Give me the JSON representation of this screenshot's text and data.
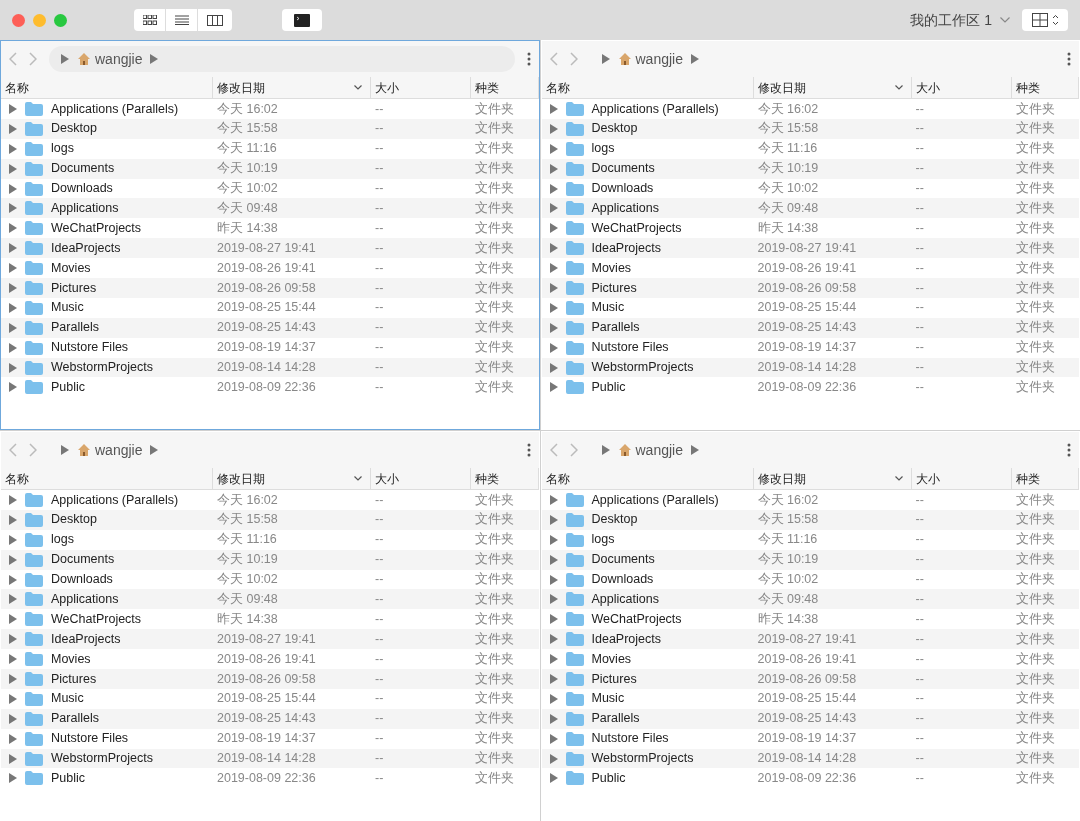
{
  "toolbar": {
    "workspace": "我的工作区 1"
  },
  "panes": [
    {
      "selected": true,
      "breadcrumb": "wangjie",
      "columns": [
        "名称",
        "修改日期",
        "大小",
        "种类"
      ],
      "rows": [
        [
          "Applications (Parallels)",
          "今天 16:02",
          "--",
          "文件夹"
        ],
        [
          "Desktop",
          "今天 15:58",
          "--",
          "文件夹"
        ],
        [
          "logs",
          "今天 11:16",
          "--",
          "文件夹"
        ],
        [
          "Documents",
          "今天 10:19",
          "--",
          "文件夹"
        ],
        [
          "Downloads",
          "今天 10:02",
          "--",
          "文件夹"
        ],
        [
          "Applications",
          "今天 09:48",
          "--",
          "文件夹"
        ],
        [
          "WeChatProjects",
          "昨天 14:38",
          "--",
          "文件夹"
        ],
        [
          "IdeaProjects",
          "2019-08-27 19:41",
          "--",
          "文件夹"
        ],
        [
          "Movies",
          "2019-08-26 19:41",
          "--",
          "文件夹"
        ],
        [
          "Pictures",
          "2019-08-26 09:58",
          "--",
          "文件夹"
        ],
        [
          "Music",
          "2019-08-25 15:44",
          "--",
          "文件夹"
        ],
        [
          "Parallels",
          "2019-08-25 14:43",
          "--",
          "文件夹"
        ],
        [
          "Nutstore Files",
          "2019-08-19 14:37",
          "--",
          "文件夹"
        ],
        [
          "WebstormProjects",
          "2019-08-14 14:28",
          "--",
          "文件夹"
        ],
        [
          "Public",
          "2019-08-09 22:36",
          "--",
          "文件夹"
        ]
      ]
    },
    {
      "selected": false,
      "breadcrumb": "wangjie",
      "columns": [
        "名称",
        "修改日期",
        "大小",
        "种类"
      ],
      "rows": [
        [
          "Applications (Parallels)",
          "今天 16:02",
          "--",
          "文件夹"
        ],
        [
          "Desktop",
          "今天 15:58",
          "--",
          "文件夹"
        ],
        [
          "logs",
          "今天 11:16",
          "--",
          "文件夹"
        ],
        [
          "Documents",
          "今天 10:19",
          "--",
          "文件夹"
        ],
        [
          "Downloads",
          "今天 10:02",
          "--",
          "文件夹"
        ],
        [
          "Applications",
          "今天 09:48",
          "--",
          "文件夹"
        ],
        [
          "WeChatProjects",
          "昨天 14:38",
          "--",
          "文件夹"
        ],
        [
          "IdeaProjects",
          "2019-08-27 19:41",
          "--",
          "文件夹"
        ],
        [
          "Movies",
          "2019-08-26 19:41",
          "--",
          "文件夹"
        ],
        [
          "Pictures",
          "2019-08-26 09:58",
          "--",
          "文件夹"
        ],
        [
          "Music",
          "2019-08-25 15:44",
          "--",
          "文件夹"
        ],
        [
          "Parallels",
          "2019-08-25 14:43",
          "--",
          "文件夹"
        ],
        [
          "Nutstore Files",
          "2019-08-19 14:37",
          "--",
          "文件夹"
        ],
        [
          "WebstormProjects",
          "2019-08-14 14:28",
          "--",
          "文件夹"
        ],
        [
          "Public",
          "2019-08-09 22:36",
          "--",
          "文件夹"
        ]
      ]
    },
    {
      "selected": false,
      "breadcrumb": "wangjie",
      "columns": [
        "名称",
        "修改日期",
        "大小",
        "种类"
      ],
      "rows": [
        [
          "Applications (Parallels)",
          "今天 16:02",
          "--",
          "文件夹"
        ],
        [
          "Desktop",
          "今天 15:58",
          "--",
          "文件夹"
        ],
        [
          "logs",
          "今天 11:16",
          "--",
          "文件夹"
        ],
        [
          "Documents",
          "今天 10:19",
          "--",
          "文件夹"
        ],
        [
          "Downloads",
          "今天 10:02",
          "--",
          "文件夹"
        ],
        [
          "Applications",
          "今天 09:48",
          "--",
          "文件夹"
        ],
        [
          "WeChatProjects",
          "昨天 14:38",
          "--",
          "文件夹"
        ],
        [
          "IdeaProjects",
          "2019-08-27 19:41",
          "--",
          "文件夹"
        ],
        [
          "Movies",
          "2019-08-26 19:41",
          "--",
          "文件夹"
        ],
        [
          "Pictures",
          "2019-08-26 09:58",
          "--",
          "文件夹"
        ],
        [
          "Music",
          "2019-08-25 15:44",
          "--",
          "文件夹"
        ],
        [
          "Parallels",
          "2019-08-25 14:43",
          "--",
          "文件夹"
        ],
        [
          "Nutstore Files",
          "2019-08-19 14:37",
          "--",
          "文件夹"
        ],
        [
          "WebstormProjects",
          "2019-08-14 14:28",
          "--",
          "文件夹"
        ],
        [
          "Public",
          "2019-08-09 22:36",
          "--",
          "文件夹"
        ]
      ]
    },
    {
      "selected": false,
      "breadcrumb": "wangjie",
      "columns": [
        "名称",
        "修改日期",
        "大小",
        "种类"
      ],
      "rows": [
        [
          "Applications (Parallels)",
          "今天 16:02",
          "--",
          "文件夹"
        ],
        [
          "Desktop",
          "今天 15:58",
          "--",
          "文件夹"
        ],
        [
          "logs",
          "今天 11:16",
          "--",
          "文件夹"
        ],
        [
          "Documents",
          "今天 10:19",
          "--",
          "文件夹"
        ],
        [
          "Downloads",
          "今天 10:02",
          "--",
          "文件夹"
        ],
        [
          "Applications",
          "今天 09:48",
          "--",
          "文件夹"
        ],
        [
          "WeChatProjects",
          "昨天 14:38",
          "--",
          "文件夹"
        ],
        [
          "IdeaProjects",
          "2019-08-27 19:41",
          "--",
          "文件夹"
        ],
        [
          "Movies",
          "2019-08-26 19:41",
          "--",
          "文件夹"
        ],
        [
          "Pictures",
          "2019-08-26 09:58",
          "--",
          "文件夹"
        ],
        [
          "Music",
          "2019-08-25 15:44",
          "--",
          "文件夹"
        ],
        [
          "Parallels",
          "2019-08-25 14:43",
          "--",
          "文件夹"
        ],
        [
          "Nutstore Files",
          "2019-08-19 14:37",
          "--",
          "文件夹"
        ],
        [
          "WebstormProjects",
          "2019-08-14 14:28",
          "--",
          "文件夹"
        ],
        [
          "Public",
          "2019-08-09 22:36",
          "--",
          "文件夹"
        ]
      ]
    }
  ]
}
